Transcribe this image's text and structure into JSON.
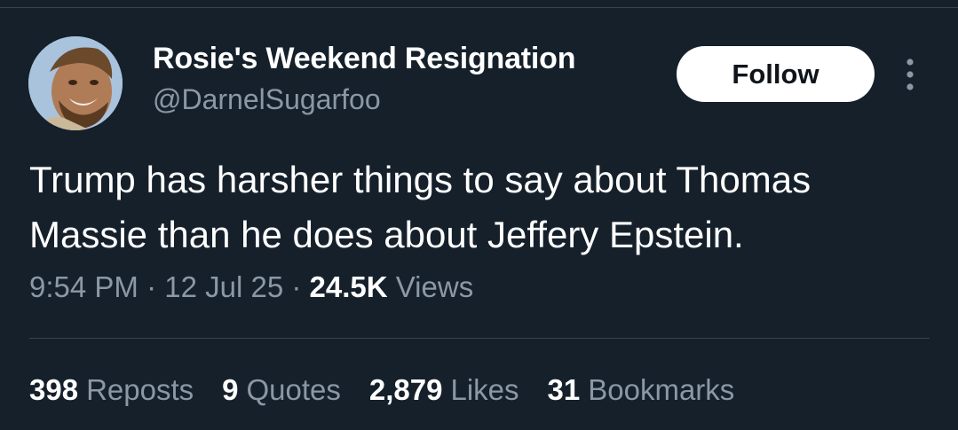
{
  "author": {
    "display_name": "Rosie's Weekend Resignation",
    "handle": "@DarnelSugarfoo"
  },
  "follow_label": "Follow",
  "more_icon": "more-options-icon",
  "tweet": {
    "text": "Trump has harsher things to say about Thomas Massie than he does about Jeffery Epstein.",
    "time": "9:54 PM",
    "separator": "·",
    "date": "12 Jul 25",
    "views_count": "24.5K",
    "views_label": "Views"
  },
  "stats": {
    "reposts": {
      "count": "398",
      "label": "Reposts"
    },
    "quotes": {
      "count": "9",
      "label": "Quotes"
    },
    "likes": {
      "count": "2,879",
      "label": "Likes"
    },
    "bookmarks": {
      "count": "31",
      "label": "Bookmarks"
    }
  },
  "colors": {
    "background": "#15202b",
    "text_primary": "#ffffff",
    "text_secondary": "#8b98a5",
    "divider": "#38444d"
  }
}
